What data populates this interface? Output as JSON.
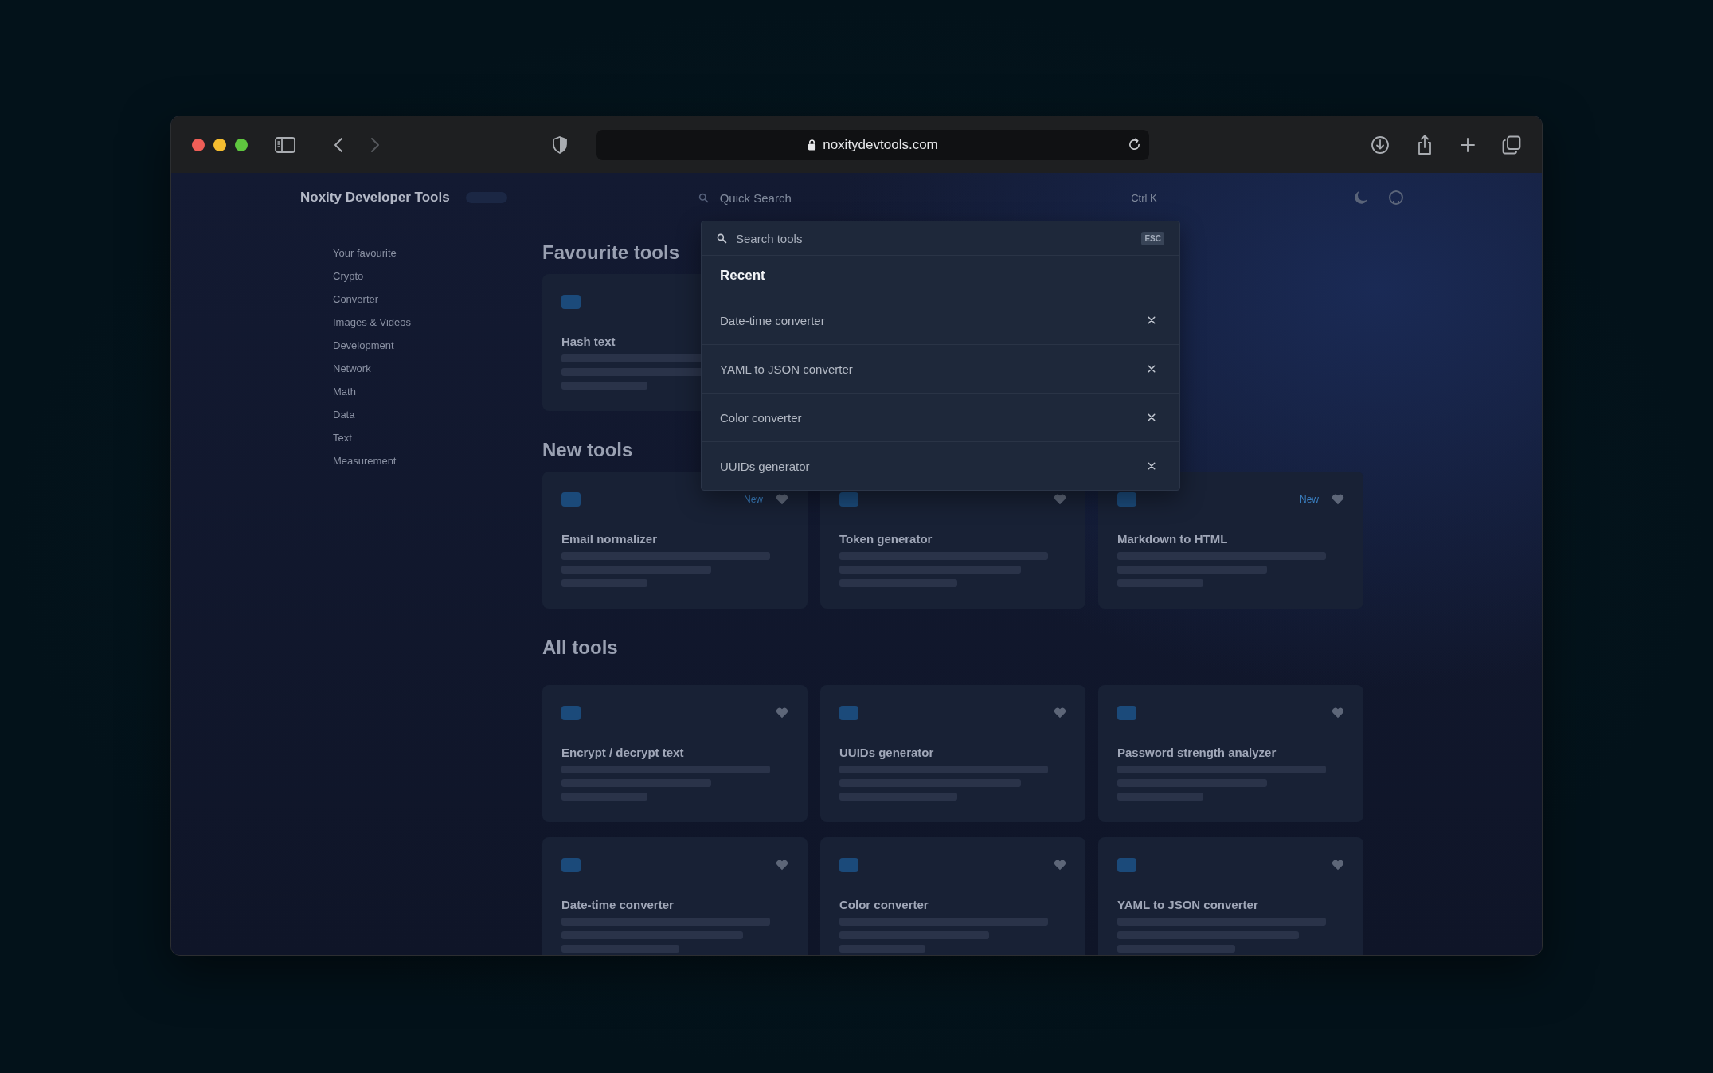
{
  "browser": {
    "url": "noxitydevtools.com"
  },
  "header": {
    "brand": "Noxity Developer Tools",
    "quick_search": {
      "placeholder": "Quick Search",
      "shortcut": "Ctrl K"
    }
  },
  "sidebar": {
    "items": [
      {
        "label": "Your favourite"
      },
      {
        "label": "Crypto"
      },
      {
        "label": "Converter"
      },
      {
        "label": "Images & Videos"
      },
      {
        "label": "Development"
      },
      {
        "label": "Network"
      },
      {
        "label": "Math"
      },
      {
        "label": "Data"
      },
      {
        "label": "Text"
      },
      {
        "label": "Measurement"
      }
    ]
  },
  "sections": [
    {
      "title": "Favourite tools",
      "cards": [
        {
          "title": "Hash text"
        }
      ]
    },
    {
      "title": "New tools",
      "cards": [
        {
          "title": "Email normalizer",
          "badge": "New"
        },
        {
          "title": "Token generator"
        },
        {
          "title": "Markdown to HTML",
          "badge": "New"
        }
      ]
    },
    {
      "title": "All tools",
      "cards": [
        {
          "title": "Encrypt / decrypt text"
        },
        {
          "title": "UUIDs generator"
        },
        {
          "title": "Password strength analyzer"
        },
        {
          "title": "Date-time converter"
        },
        {
          "title": "Color converter"
        },
        {
          "title": "YAML to JSON converter"
        }
      ]
    }
  ],
  "search_dialog": {
    "placeholder": "Search tools",
    "key_hint": "ESC",
    "heading": "Recent",
    "items": [
      {
        "label": "Date-time converter"
      },
      {
        "label": "YAML to JSON converter"
      },
      {
        "label": "Color converter"
      },
      {
        "label": "UUIDs generator"
      }
    ]
  }
}
